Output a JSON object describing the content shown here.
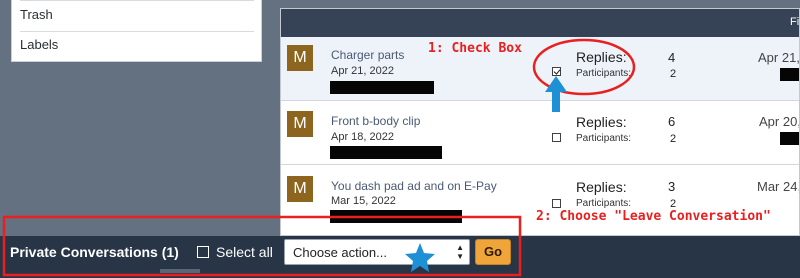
{
  "sidebar": {
    "items": [
      {
        "label": "Trash"
      },
      {
        "label": "Labels"
      }
    ]
  },
  "panel": {
    "header_text": "Fi"
  },
  "conversations": [
    {
      "avatar": "M",
      "title": "Charger parts",
      "date": "Apr 21, 2022",
      "checked": true,
      "replies_label": "Replies:",
      "replies": "4",
      "participants_label": "Participants:",
      "participants": "2",
      "last_date": "Apr 21,"
    },
    {
      "avatar": "M",
      "title": "Front b-body clip",
      "date": "Apr 18, 2022",
      "checked": false,
      "replies_label": "Replies:",
      "replies": "6",
      "participants_label": "Participants:",
      "participants": "2",
      "last_date": "Apr 20,"
    },
    {
      "avatar": "M",
      "title": "You dash pad ad and on E-Pay",
      "date": "Mar 15, 2022",
      "checked": false,
      "replies_label": "Replies:",
      "replies": "3",
      "participants_label": "Participants:",
      "participants": "2",
      "last_date": "Mar 24,"
    }
  ],
  "bottom_bar": {
    "title": "Private Conversations (1)",
    "select_all_label": "Select all",
    "action_value": "Choose action...",
    "go_label": "Go"
  },
  "annotations": {
    "step1": "1: Check Box",
    "step2": "2: Choose \"Leave Conversation\"",
    "color": "#e8201f",
    "arrow_color": "#1e90d6",
    "star_color": "#1e90d6"
  },
  "colors": {
    "avatar_bg": "#8d651f",
    "bottom_bar_bg": "#283547",
    "go_button_bg": "#f0a53b"
  }
}
